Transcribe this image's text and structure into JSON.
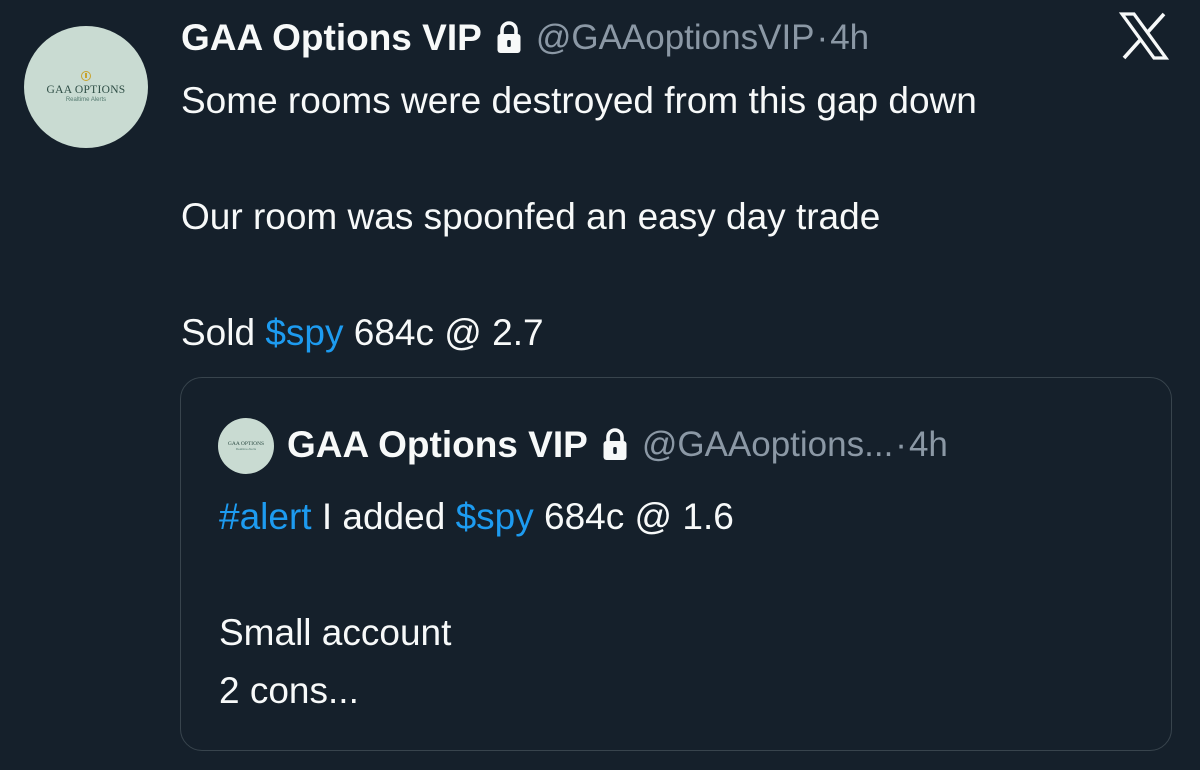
{
  "tweet": {
    "author_name": "GAA Options VIP",
    "handle": "@GAAoptionsVIP",
    "separator": "·",
    "time": "4h",
    "avatar": {
      "brand": "GAA OPTIONS",
      "tagline": "Realtime Alerts"
    },
    "lines": {
      "line1": "Some rooms were destroyed from this gap down",
      "line2": "Our room was spoonfed an easy day trade",
      "line3_prefix": "Sold ",
      "line3_link": "$spy",
      "line3_suffix": " 684c @ 2.7"
    }
  },
  "quoted_tweet": {
    "author_name": "GAA Options VIP",
    "handle": "@GAAoptions...",
    "separator": "·",
    "time": "4h",
    "avatar": {
      "brand": "GAA OPTIONS",
      "tagline": "Realtime Alerts"
    },
    "lines": {
      "hashtag": "#alert",
      "text_mid": " I added ",
      "cashtag": "$spy",
      "text_end": " 684c @ 1.6",
      "line2": "Small account",
      "line3": "2 cons..."
    }
  },
  "icons": {
    "lock": "lock-icon",
    "platform_logo": "x-logo-icon"
  },
  "colors": {
    "background": "#15202b",
    "text": "#f7f9f9",
    "muted": "#8b98a5",
    "link": "#1d9bf0",
    "border": "#38444d"
  }
}
